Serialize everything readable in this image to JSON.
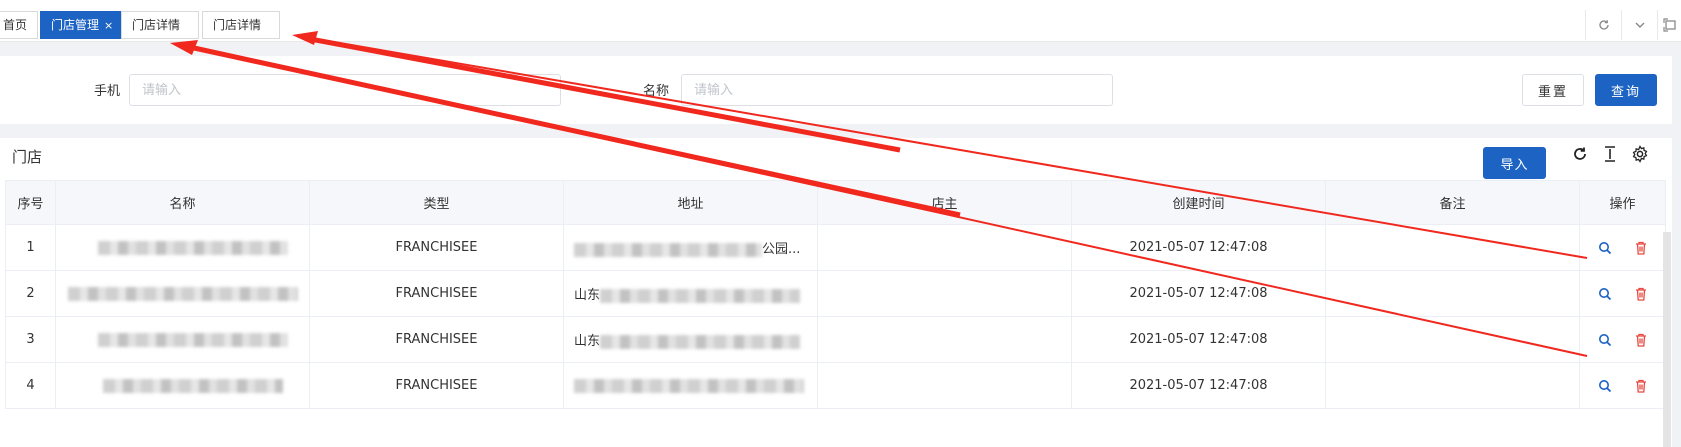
{
  "tabs": [
    {
      "label": "首页",
      "active": false
    },
    {
      "label": "门店管理",
      "active": true,
      "close": "×"
    },
    {
      "label": "门店详情",
      "active": false
    },
    {
      "label": "门店详情",
      "active": false
    }
  ],
  "search": {
    "phone_label": "手机",
    "phone_placeholder": "请输入",
    "name_label": "名称",
    "name_placeholder": "请输入",
    "reset_label": "重置",
    "query_label": "查询"
  },
  "table_card": {
    "title": "门店",
    "import_label": "导入"
  },
  "table": {
    "headers": [
      "序号",
      "名称",
      "类型",
      "地址",
      "店主",
      "创建时间",
      "备注",
      "操作"
    ],
    "rows": [
      {
        "index": "1",
        "type": "FRANCHISEE",
        "address_visible": "公园...",
        "created": "2021-05-07 12:47:08"
      },
      {
        "index": "2",
        "type": "FRANCHISEE",
        "address_visible": "山东",
        "created": "2021-05-07 12:47:08"
      },
      {
        "index": "3",
        "type": "FRANCHISEE",
        "address_visible": "山东",
        "created": "2021-05-07 12:47:08"
      },
      {
        "index": "4",
        "type": "FRANCHISEE",
        "address_visible": "",
        "created": "2021-05-07 12:47:08"
      }
    ]
  },
  "colors": {
    "primary": "#1d63c4",
    "delete": "#e8483f",
    "arrow": "#f0281e"
  }
}
